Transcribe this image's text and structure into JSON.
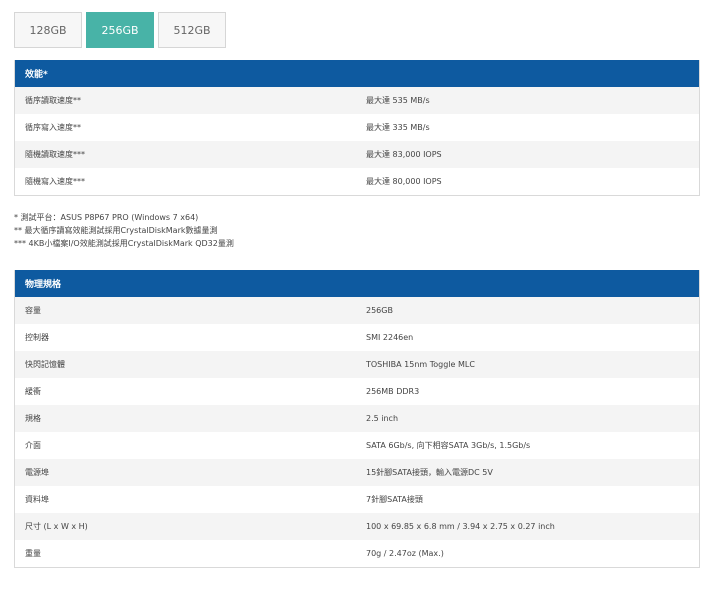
{
  "tabs": [
    {
      "label": "128GB",
      "active": false
    },
    {
      "label": "256GB",
      "active": true
    },
    {
      "label": "512GB",
      "active": false
    }
  ],
  "performance": {
    "title": "效能*",
    "rows": [
      {
        "label": "循序讀取速度**",
        "value": "最大達 535 MB/s"
      },
      {
        "label": "循序寫入速度**",
        "value": "最大達 335 MB/s"
      },
      {
        "label": "隨機讀取速度***",
        "value": "最大達 83,000 IOPS"
      },
      {
        "label": "隨機寫入速度***",
        "value": "最大達 80,000 IOPS"
      }
    ]
  },
  "notes": [
    "* 測試平台：ASUS P8P67 PRO (Windows 7 x64)",
    "** 最大循序讀寫效能測試採用CrystalDiskMark數據量測",
    "*** 4KB小檔案I/O效能測試採用CrystalDiskMark QD32量測"
  ],
  "specs": {
    "title": "物理規格",
    "rows": [
      {
        "label": "容量",
        "value": "256GB"
      },
      {
        "label": "控制器",
        "value": "SMI 2246en"
      },
      {
        "label": "快閃記憶體",
        "value": "TOSHIBA 15nm Toggle MLC"
      },
      {
        "label": "緩衝",
        "value": "256MB DDR3"
      },
      {
        "label": "規格",
        "value": "2.5 inch"
      },
      {
        "label": "介面",
        "value": "SATA 6Gb/s, 向下相容SATA 3Gb/s, 1.5Gb/s"
      },
      {
        "label": "電源埠",
        "value": "15針腳SATA接頭，輸入電源DC 5V"
      },
      {
        "label": "資料埠",
        "value": "7針腳SATA接頭"
      },
      {
        "label": "尺寸 (L x W x H)",
        "value": "100 x 69.85 x 6.8 mm / 3.94 x 2.75 x 0.27 inch"
      },
      {
        "label": "重量",
        "value": "70g / 2.47oz (Max.)"
      }
    ]
  }
}
